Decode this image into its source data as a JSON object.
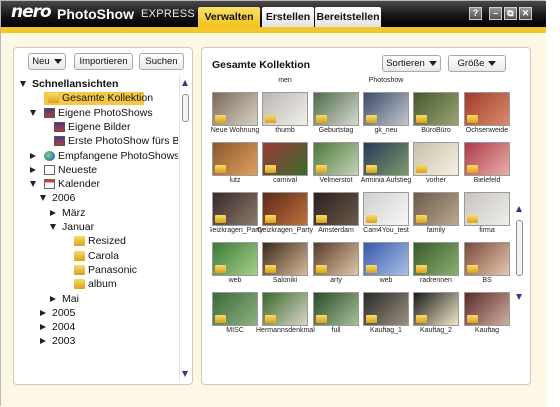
{
  "app": {
    "logo_nero": "nero",
    "logo_product": "PhotoShow",
    "logo_edition": "EXPRESS",
    "tabs": [
      {
        "label": "Verwalten",
        "active": true
      },
      {
        "label": "Erstellen",
        "active": false
      },
      {
        "label": "Bereitstellen",
        "active": false
      }
    ],
    "window_controls": {
      "help": "?",
      "minimize": "–",
      "restore": "⧉",
      "close": "✕"
    },
    "colors": {
      "accent": "#f2c21b",
      "topbar": "#161616",
      "workspace": "#fdf7e5"
    }
  },
  "left_panel": {
    "buttons": {
      "new": "Neu",
      "import": "Importieren",
      "search": "Suchen"
    },
    "tree": [
      {
        "label": "Schnellansichten",
        "bold": true,
        "expander": "down",
        "icon": "",
        "selected": false
      },
      {
        "label": "Gesamte Kollektion",
        "bold": false,
        "expander": "",
        "icon": "folder-icon",
        "selected": true
      },
      {
        "label": "Eigene PhotoShows",
        "bold": false,
        "expander": "down",
        "icon": "photoshow-icon",
        "selected": false
      },
      {
        "label": "Eigene Bilder",
        "bold": false,
        "expander": "",
        "icon": "photoshow-icon",
        "selected": false
      },
      {
        "label": "Erste PhotoShow fürs Baby",
        "bold": false,
        "expander": "",
        "icon": "photoshow-icon",
        "selected": false
      },
      {
        "label": "Empfangene PhotoShows",
        "bold": false,
        "expander": "right",
        "icon": "globe-icon",
        "selected": false
      },
      {
        "label": "Neueste",
        "bold": false,
        "expander": "right",
        "icon": "document-icon",
        "selected": false
      },
      {
        "label": "Kalender",
        "bold": false,
        "expander": "down",
        "icon": "calendar-icon",
        "selected": false
      },
      {
        "label": "2006",
        "bold": false,
        "expander": "down",
        "icon": "",
        "selected": false
      },
      {
        "label": "März",
        "bold": false,
        "expander": "right",
        "icon": "",
        "selected": false
      },
      {
        "label": "Januar",
        "bold": false,
        "expander": "down",
        "icon": "",
        "selected": false
      },
      {
        "label": "Resized",
        "bold": false,
        "expander": "",
        "icon": "folder-icon",
        "selected": false
      },
      {
        "label": "Carola",
        "bold": false,
        "expander": "",
        "icon": "folder-icon",
        "selected": false
      },
      {
        "label": "Panasonic",
        "bold": false,
        "expander": "",
        "icon": "folder-icon",
        "selected": false
      },
      {
        "label": "album",
        "bold": false,
        "expander": "",
        "icon": "folder-icon",
        "selected": false
      },
      {
        "label": "Mai",
        "bold": false,
        "expander": "right",
        "icon": "",
        "selected": false
      },
      {
        "label": "2005",
        "bold": false,
        "expander": "right",
        "icon": "",
        "selected": false
      },
      {
        "label": "2004",
        "bold": false,
        "expander": "right",
        "icon": "",
        "selected": false
      },
      {
        "label": "2003",
        "bold": false,
        "expander": "right",
        "icon": "",
        "selected": false
      }
    ]
  },
  "right_panel": {
    "title": "Gesamte Kollektion",
    "sort_label": "Sortieren",
    "size_label": "Größe",
    "row0_partial_captions": [
      "",
      "men",
      "",
      "Photoshow",
      "",
      ""
    ],
    "thumbnails": [
      {
        "caption": "Neue Wohnung",
        "colors": [
          "#7a6a5a",
          "#d8d0c4"
        ]
      },
      {
        "caption": "thumb",
        "colors": [
          "#b9b6b0",
          "#f2f0ec"
        ]
      },
      {
        "caption": "Geburtstag",
        "colors": [
          "#4d6b4a",
          "#d9d9d0"
        ]
      },
      {
        "caption": "gk_neu",
        "colors": [
          "#3c4a6a",
          "#c3c7cf"
        ]
      },
      {
        "caption": "BüroBüro",
        "colors": [
          "#45592f",
          "#9aa472"
        ]
      },
      {
        "caption": "Ochsenweide",
        "colors": [
          "#a33a2c",
          "#d98d6c"
        ]
      },
      {
        "caption": "lutz",
        "colors": [
          "#8a5a2a",
          "#e0a060"
        ]
      },
      {
        "caption": "carnival",
        "colors": [
          "#9a3a3a",
          "#3a6a2a"
        ]
      },
      {
        "caption": "Velmerstot",
        "colors": [
          "#4a7a3a",
          "#c8d0b8"
        ]
      },
      {
        "caption": "Arminia Aufstieg",
        "colors": [
          "#2a3a5a",
          "#7a9a6a"
        ]
      },
      {
        "caption": "vorher",
        "colors": [
          "#c8c0a8",
          "#f4f0e4"
        ]
      },
      {
        "caption": "Bielefeld",
        "colors": [
          "#b03a4a",
          "#e8b0a8"
        ]
      },
      {
        "caption": "Geizkragen_Party",
        "colors": [
          "#3a2a2a",
          "#8a7a6a"
        ]
      },
      {
        "caption": "Geizkragen_Party",
        "colors": [
          "#5a2a1a",
          "#c0703a"
        ]
      },
      {
        "caption": "Amsterdam",
        "colors": [
          "#2a2020",
          "#6a5a4a"
        ]
      },
      {
        "caption": "Cam4You_test",
        "colors": [
          "#d0d0d0",
          "#f8f8f8"
        ]
      },
      {
        "caption": "family",
        "colors": [
          "#6a5a4a",
          "#bca890"
        ]
      },
      {
        "caption": "firma",
        "colors": [
          "#c8c4c0",
          "#eeeeec"
        ]
      },
      {
        "caption": "web",
        "colors": [
          "#3a7a3a",
          "#a8d088"
        ]
      },
      {
        "caption": "Saloniki",
        "colors": [
          "#3a2a1a",
          "#d8b898"
        ]
      },
      {
        "caption": "arty",
        "colors": [
          "#5a3a2a",
          "#e0c8a8"
        ]
      },
      {
        "caption": "web",
        "colors": [
          "#3a5aaa",
          "#a8c0e8"
        ]
      },
      {
        "caption": "radrennen",
        "colors": [
          "#3a5a2a",
          "#8ab070"
        ]
      },
      {
        "caption": "BS",
        "colors": [
          "#7a4a3a",
          "#e8c8b0"
        ]
      },
      {
        "caption": "MISC",
        "colors": [
          "#3a6a3a",
          "#90b080"
        ]
      },
      {
        "caption": "Hermannsdenkmal",
        "colors": [
          "#3a6a2a",
          "#d8d4c8"
        ]
      },
      {
        "caption": "full",
        "colors": [
          "#2a4a2a",
          "#a8c098"
        ]
      },
      {
        "caption": "Kauftag_1",
        "colors": [
          "#2a2a2a",
          "#9a9080"
        ]
      },
      {
        "caption": "Kauftag_2",
        "colors": [
          "#1a1a1a",
          "#f0e8c8"
        ]
      },
      {
        "caption": "Kauftag",
        "colors": [
          "#5a2a2a",
          "#d0b0a0"
        ]
      }
    ]
  }
}
